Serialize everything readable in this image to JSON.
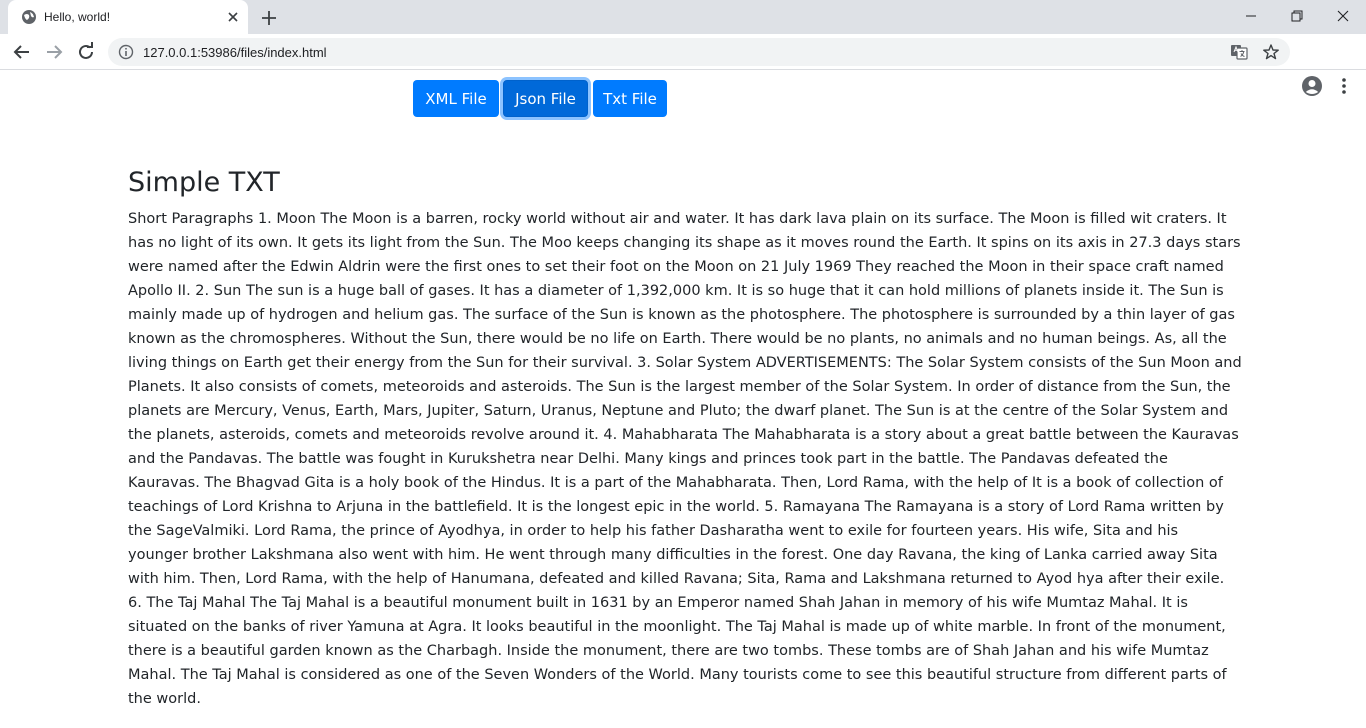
{
  "browser": {
    "tab_title": "Hello, world!",
    "url": "127.0.0.1:53986/files/index.html"
  },
  "page": {
    "buttons": [
      "XML File",
      "Json File",
      "Txt File"
    ],
    "heading": "Simple TXT",
    "paragraph": "Short Paragraphs 1. Moon The Moon is a barren, rocky world without air and water. It has dark lava plain on its surface. The Moon is filled wit craters. It has no light of its own. It gets its light from the Sun. The Moo keeps changing its shape as it moves round the Earth. It spins on its axis in 27.3 days stars were named after the Edwin Aldrin were the first ones to set their foot on the Moon on 21 July 1969 They reached the Moon in their space craft named Apollo II. 2. Sun The sun is a huge ball of gases. It has a diameter of 1,392,000 km. It is so huge that it can hold millions of planets inside it. The Sun is mainly made up of hydrogen and helium gas. The surface of the Sun is known as the photosphere. The photosphere is surrounded by a thin layer of gas known as the chromospheres. Without the Sun, there would be no life on Earth. There would be no plants, no animals and no human beings. As, all the living things on Earth get their energy from the Sun for their survival. 3. Solar System ADVERTISEMENTS: The Solar System consists of the Sun Moon and Planets. It also consists of comets, meteoroids and asteroids. The Sun is the largest member of the Solar System. In order of distance from the Sun, the planets are Mercury, Venus, Earth, Mars, Jupiter, Saturn, Uranus, Neptune and Pluto; the dwarf planet. The Sun is at the centre of the Solar System and the planets, asteroids, comets and meteoroids revolve around it. 4. Mahabharata The Mahabharata is a story about a great battle between the Kauravas and the Pandavas. The battle was fought in Kurukshetra near Delhi. Many kings and princes took part in the battle. The Pandavas defeated the Kauravas. The Bhagvad Gita is a holy book of the Hindus. It is a part of the Mahabharata. Then, Lord Rama, with the help of It is a book of collection of teachings of Lord Krishna to Arjuna in the battlefield. It is the longest epic in the world. 5. Ramayana The Ramayana is a story of Lord Rama written by the SageValmiki. Lord Rama, the prince of Ayodhya, in order to help his father Dasharatha went to exile for fourteen years. His wife, Sita and his younger brother Lakshmana also went with him. He went through many difficulties in the forest. One day Ravana, the king of Lanka carried away Sita with him. Then, Lord Rama, with the help of Hanumana, defeated and killed Ravana; Sita, Rama and Lakshmana returned to Ayod hya after their exile. 6. The Taj Mahal The Taj Mahal is a beautiful monument built in 1631 by an Emperor named Shah Jahan in memory of his wife Mumtaz Mahal. It is situated on the banks of river Yamuna at Agra. It looks beautiful in the moonlight. The Taj Mahal is made up of white marble. In front of the monument, there is a beautiful garden known as the Charbagh. Inside the monument, there are two tombs. These tombs are of Shah Jahan and his wife Mumtaz Mahal. The Taj Mahal is considered as one of the Seven Wonders of the World. Many tourists come to see this beautiful structure from different parts of the world."
  },
  "icons": {
    "tab_favicon": "globe-icon",
    "tab_close": "close-icon",
    "new_tab": "plus-icon",
    "minimize": "minimize-icon",
    "maximize": "restore-icon",
    "close_window": "close-icon",
    "back": "back-arrow-icon",
    "forward": "forward-arrow-icon",
    "reload": "reload-icon",
    "site_info": "info-icon",
    "translate": "translate-icon",
    "bookmark": "star-icon",
    "profile": "account-icon",
    "menu": "kebab-menu-icon"
  },
  "colors": {
    "primary_button": "#007bff",
    "primary_button_focus": "#0069d9",
    "tabstrip_bg": "#dee1e6",
    "omnibox_bg": "#f1f3f4",
    "text": "#212529"
  }
}
